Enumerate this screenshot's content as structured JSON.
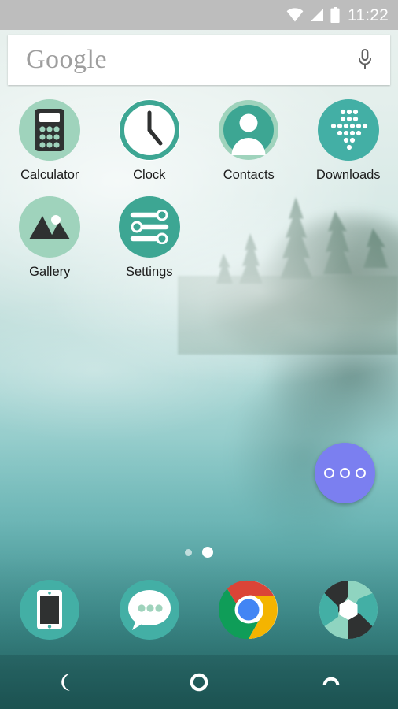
{
  "status_bar": {
    "time": "11:22",
    "icons": [
      "wifi-icon",
      "cellular-signal-icon",
      "battery-full-icon"
    ],
    "background_color": "#bdbdbd",
    "text_color": "#ffffff"
  },
  "search_bar": {
    "logo_text": "Google",
    "mic_icon": "microphone-icon",
    "background_color": "#ffffff",
    "logo_color": "#9e9e9e"
  },
  "apps": [
    {
      "label": "Calculator",
      "icon": "calculator-icon",
      "circle_color": "#9fd3bc"
    },
    {
      "label": "Clock",
      "icon": "clock-icon",
      "circle_color": "#ffffff"
    },
    {
      "label": "Contacts",
      "icon": "contacts-icon",
      "circle_color": "#3da693"
    },
    {
      "label": "Downloads",
      "icon": "downloads-icon",
      "circle_color": "#43afa5"
    },
    {
      "label": "Gallery",
      "icon": "gallery-icon",
      "circle_color": "#9fd3bc"
    },
    {
      "label": "Settings",
      "icon": "settings-icon",
      "circle_color": "#3da693"
    }
  ],
  "fab": {
    "icon": "overflow-menu-icon",
    "color": "#7b7ff0",
    "dots": 3
  },
  "page_indicator": {
    "total_pages": 2,
    "current_page": 2
  },
  "dock": [
    {
      "label": "Phone",
      "icon": "phone-icon",
      "circle_color": "#43afa5"
    },
    {
      "label": "Messaging",
      "icon": "messaging-icon",
      "circle_color": "#43afa5"
    },
    {
      "label": "Chrome",
      "icon": "chrome-icon",
      "circle_color": "transparent"
    },
    {
      "label": "Camera",
      "icon": "camera-icon",
      "circle_color": "transparent"
    }
  ],
  "nav_bar": [
    {
      "label": "Back",
      "icon": "back-crescent-icon"
    },
    {
      "label": "Home",
      "icon": "home-ring-icon"
    },
    {
      "label": "Recents",
      "icon": "recents-arc-icon"
    }
  ],
  "wallpaper": {
    "description": "Misty lake with fog-shrouded evergreen forest",
    "top_color": "#e9f1ee",
    "bottom_color": "#2a6f6e"
  }
}
